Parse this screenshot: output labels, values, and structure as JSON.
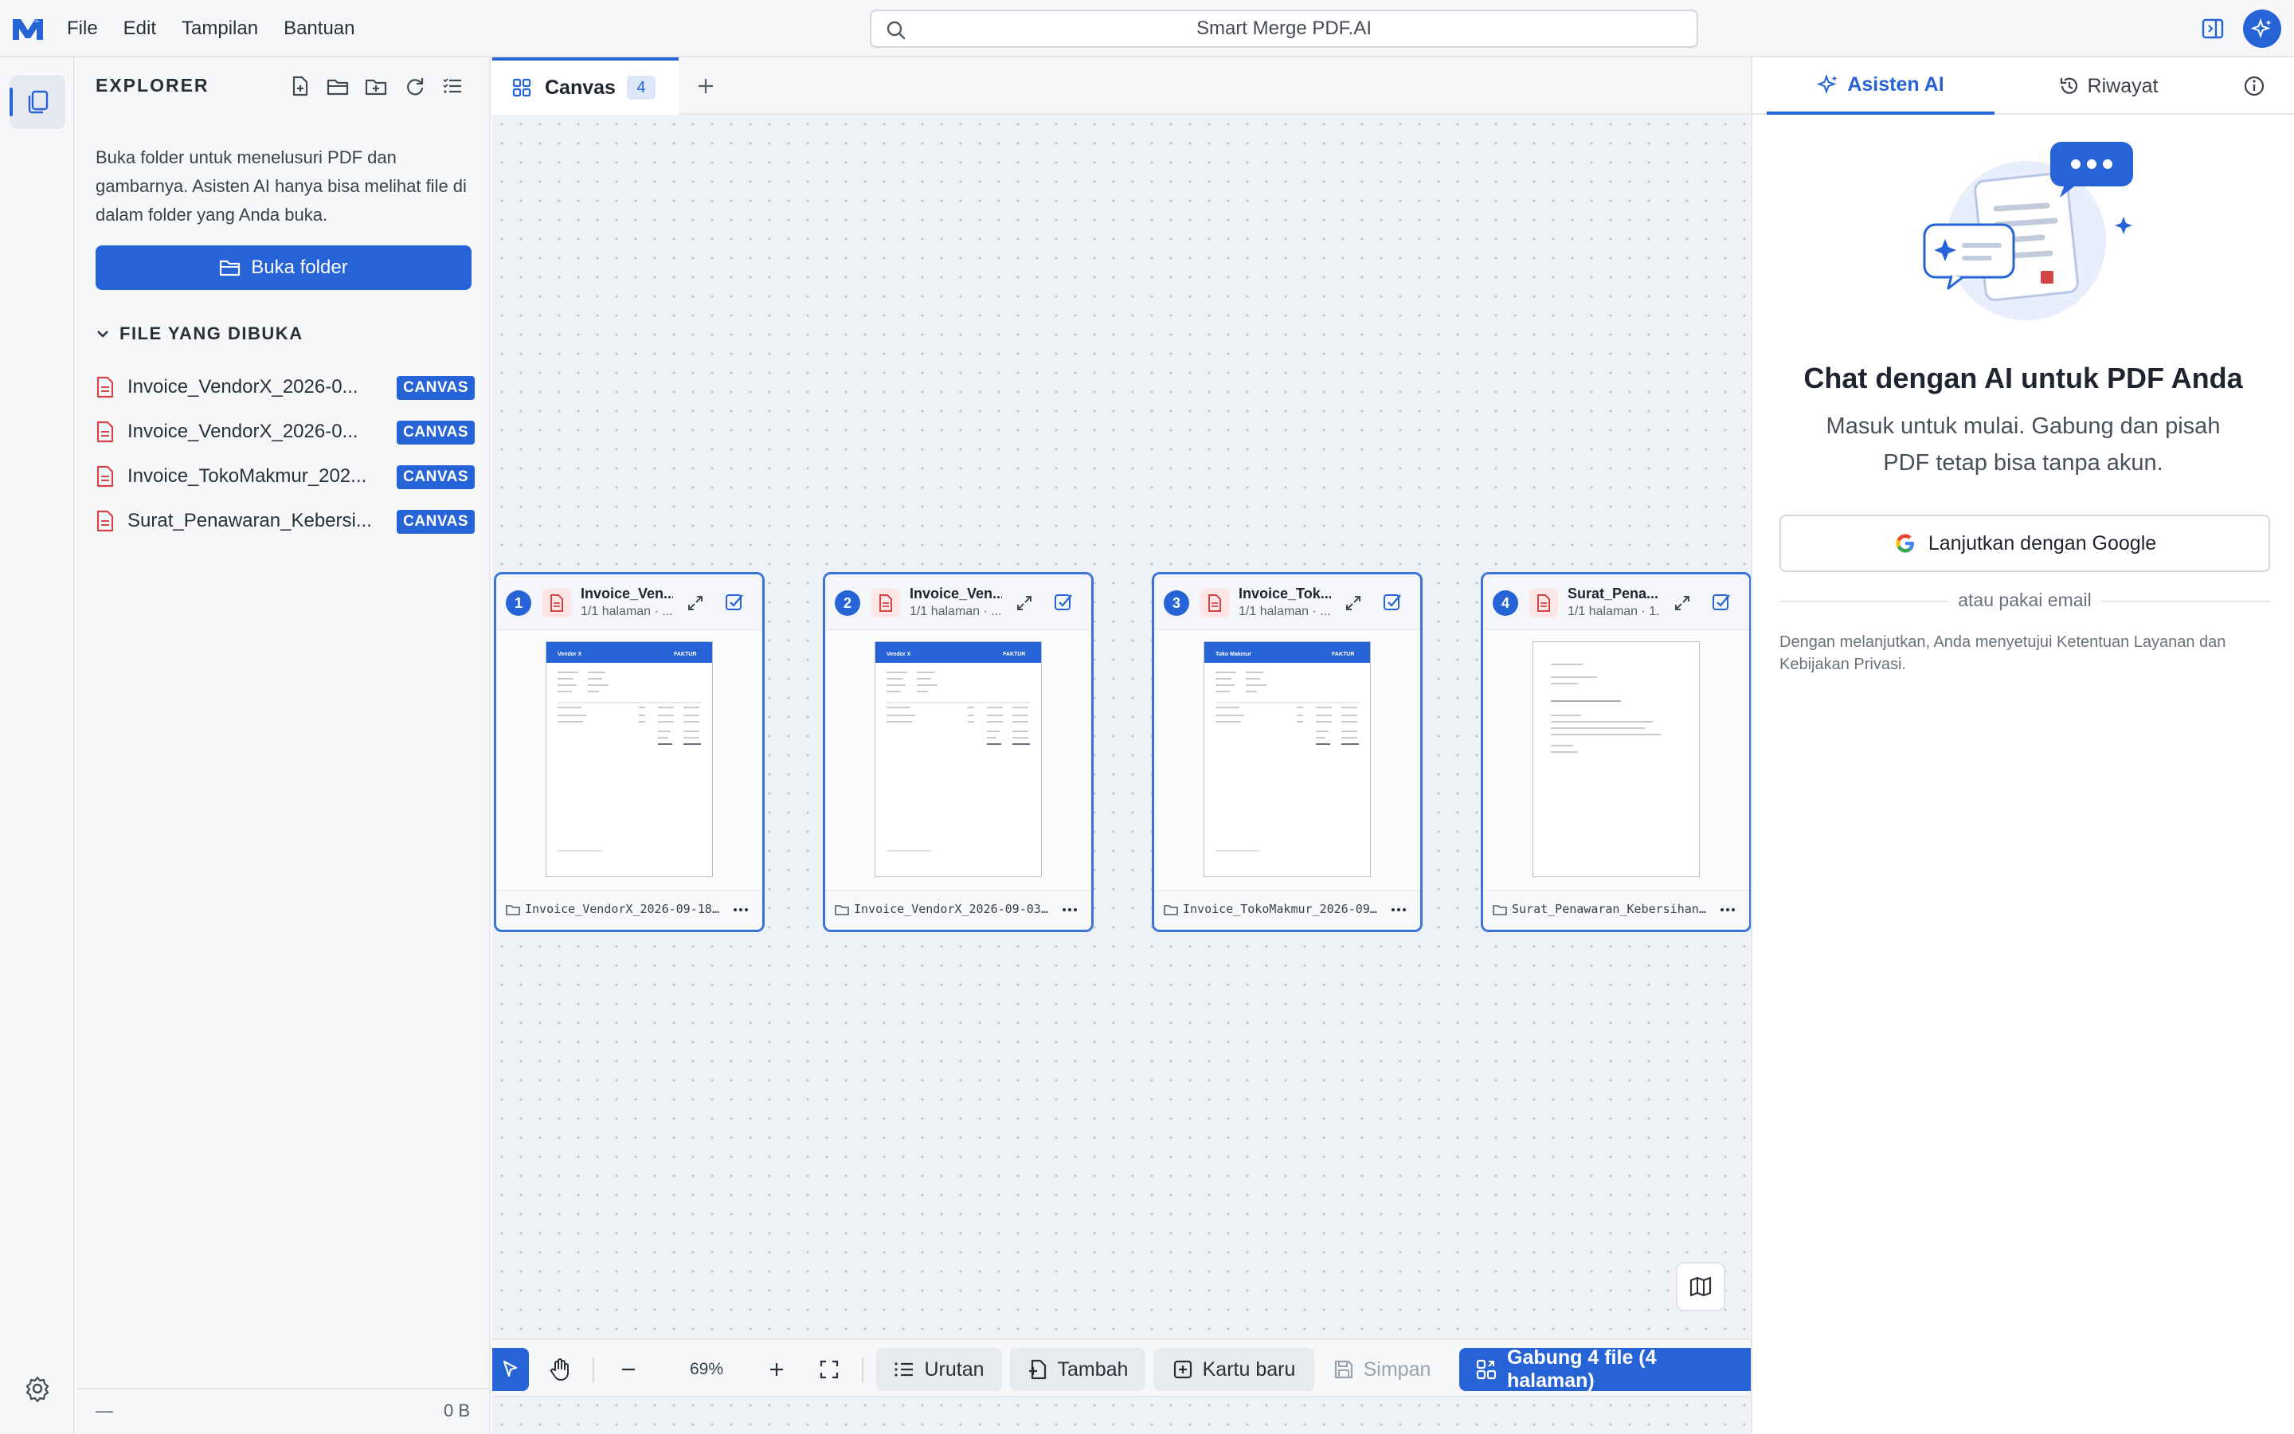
{
  "menu": {
    "items": [
      "File",
      "Edit",
      "Tampilan",
      "Bantuan"
    ]
  },
  "search": {
    "title": "Smart Merge PDF.AI"
  },
  "explorer": {
    "title": "EXPLORER",
    "description": "Buka folder untuk menelusuri PDF dan gambarnya. Asisten AI hanya bisa melihat file di dalam folder yang Anda buka.",
    "open_folder_label": "Buka folder",
    "section_title": "FILE YANG DIBUKA",
    "files": [
      {
        "name": "Invoice_VendorX_2026-0...",
        "badge": "CANVAS"
      },
      {
        "name": "Invoice_VendorX_2026-0...",
        "badge": "CANVAS"
      },
      {
        "name": "Invoice_TokoMakmur_202...",
        "badge": "CANVAS"
      },
      {
        "name": "Surat_Penawaran_Kebersi...",
        "badge": "CANVAS"
      }
    ],
    "footer": {
      "left": "—",
      "size": "0 B"
    }
  },
  "tabs": {
    "active_label": "Canvas",
    "active_count": "4"
  },
  "cards": [
    {
      "num": "1",
      "title": "Invoice_Ven...",
      "sub": "1/1 halaman · ...",
      "filename": "Invoice_VendorX_2026-09-18.p...",
      "doc": "Vendor X",
      "doc_tag": "FAKTUR"
    },
    {
      "num": "2",
      "title": "Invoice_Ven...",
      "sub": "1/1 halaman · ...",
      "filename": "Invoice_VendorX_2026-09-03.p...",
      "doc": "Vendor X",
      "doc_tag": "FAKTUR"
    },
    {
      "num": "3",
      "title": "Invoice_Tok...",
      "sub": "1/1 halaman · ...",
      "filename": "Invoice_TokoMakmur_2026-09-1...",
      "doc": "Toko Makmur",
      "doc_tag": "FAKTUR"
    },
    {
      "num": "4",
      "title": "Surat_Pena...",
      "sub": "1/1 halaman · 1...",
      "filename": "Surat_Penawaran_Kebersihan.p...",
      "doc": "",
      "doc_tag": ""
    }
  ],
  "toolbar": {
    "zoom": "69%",
    "order_label": "Urutan",
    "add_label": "Tambah",
    "new_card_label": "Kartu baru",
    "save_label": "Simpan",
    "merge_label": "Gabung 4 file (4 halaman)"
  },
  "ai": {
    "tab_assist": "Asisten AI",
    "tab_history": "Riwayat",
    "heading": "Chat dengan AI untuk PDF Anda",
    "subtitle": "Masuk untuk mulai. Gabung dan pisah PDF tetap bisa tanpa akun.",
    "google_label": "Lanjutkan dengan Google",
    "divider": "atau pakai email",
    "terms": "Dengan melanjutkan, Anda menyetujui Ketentuan Layanan dan Kebijakan Privasi."
  },
  "colors": {
    "accent": "#2563d6",
    "canvas_bg": "#eef1f6",
    "pdf_red": "#d64545"
  },
  "icons": [
    "app-logo",
    "search-icon",
    "panel-toggle-icon",
    "sparkle-icon",
    "files-icon",
    "settings-icon",
    "new-file-icon",
    "open-folder-icon",
    "new-folder-icon",
    "refresh-icon",
    "list-icon",
    "chevron-down-icon",
    "pdf-file-icon",
    "grid-icon",
    "plus-icon",
    "expand-icon",
    "check-square-icon",
    "folder-icon",
    "more-icon",
    "map-icon",
    "cursor-icon",
    "hand-icon",
    "minus-icon",
    "fit-screen-icon",
    "order-list-icon",
    "add-file-icon",
    "add-card-icon",
    "save-icon",
    "merge-icon",
    "history-icon",
    "info-icon",
    "google-icon"
  ]
}
